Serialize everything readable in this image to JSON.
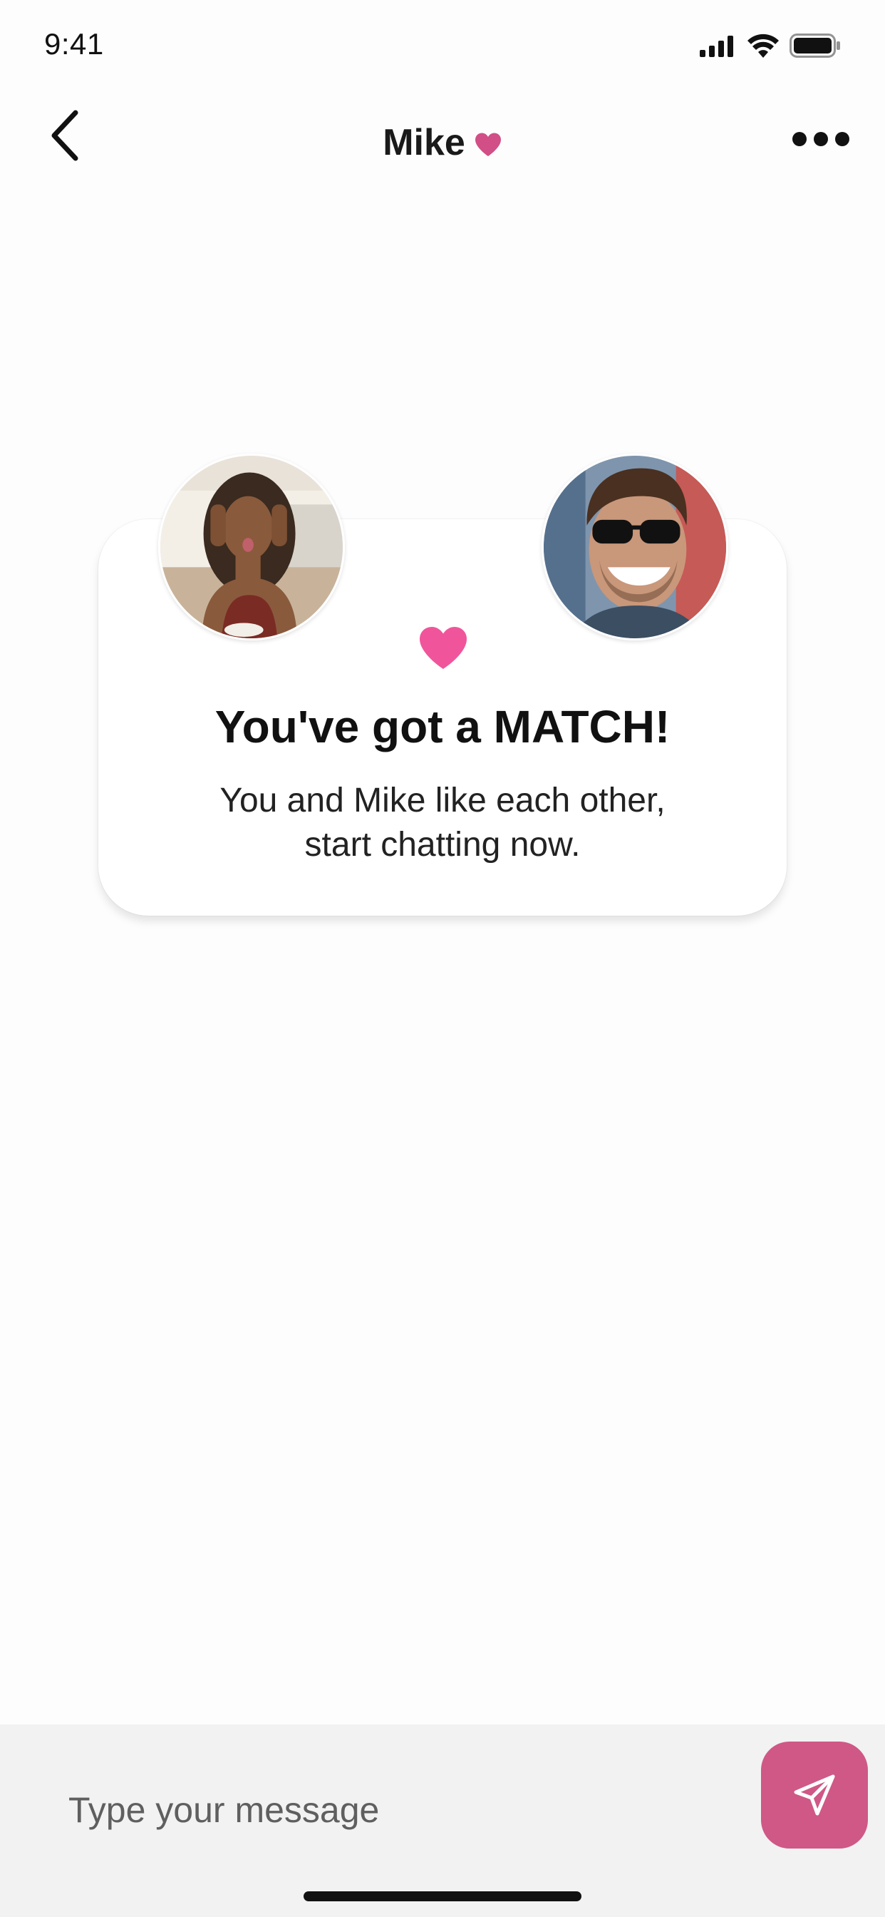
{
  "status_bar": {
    "time": "9:41",
    "icons": [
      "signal-icon",
      "wifi-icon",
      "battery-icon"
    ]
  },
  "nav": {
    "title": "Mike",
    "back_icon": "chevron-left-icon",
    "title_icon": "heart-icon",
    "more_icon": "more-horizontal-icon"
  },
  "match_card": {
    "headline": "You've got a MATCH!",
    "subtext_line1": "You and Mike like each other,",
    "subtext_line2": "start chatting now.",
    "heart_icon": "heart-icon",
    "left_avatar": "user-avatar",
    "right_avatar": "match-avatar"
  },
  "composer": {
    "placeholder": "Type your message",
    "value": "",
    "send_icon": "send-icon"
  },
  "colors": {
    "accent_pink": "#f0559b",
    "title_heart": "#d14f86",
    "send_button": "#cf5886",
    "composer_bg": "#f2f2f2"
  }
}
